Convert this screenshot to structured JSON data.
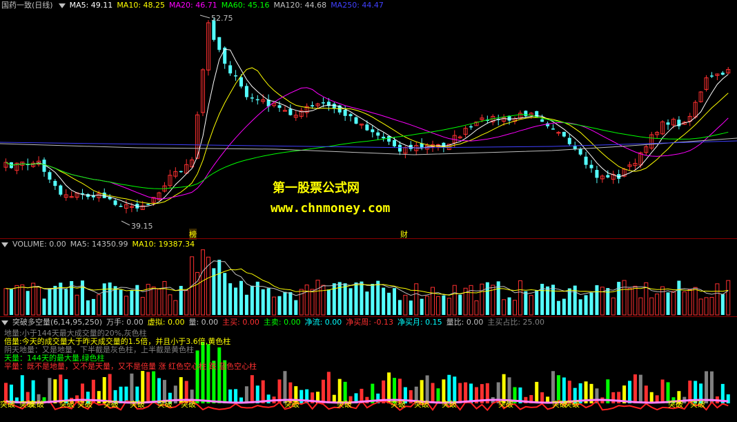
{
  "price_panel": {
    "title": "国药一致(日线)",
    "ma_labels": [
      {
        "text": "MA5: 49.11",
        "color": "#ffffff"
      },
      {
        "text": "MA10: 48.25",
        "color": "#ffff00"
      },
      {
        "text": "MA20: 46.71",
        "color": "#ff00ff"
      },
      {
        "text": "MA60: 45.16",
        "color": "#00ff00"
      },
      {
        "text": "MA120: 44.68",
        "color": "#c0c0c0"
      },
      {
        "text": "MA250: 44.47",
        "color": "#4040ff"
      }
    ],
    "high_label": "52.75",
    "low_label": "39.15",
    "marker_bang": "榜",
    "marker_cai": "财",
    "watermark_cn": "第一股票公式网",
    "watermark_url": "www.chnmoney.com"
  },
  "volume_panel": {
    "labels": [
      {
        "text": "VOLUME: 0.00",
        "color": "#c0c0c0"
      },
      {
        "text": "MA5: 14350.99",
        "color": "#c0c0c0"
      },
      {
        "text": "MA10: 19387.34",
        "color": "#ffff00"
      }
    ]
  },
  "indicator_panel": {
    "labels": [
      {
        "text": "突破多空量(6,14,95,250)",
        "color": "#c0c0c0"
      },
      {
        "text": "万手: 0.00",
        "color": "#c0c0c0"
      },
      {
        "text": "虚拟: 0.00",
        "color": "#ffff00"
      },
      {
        "text": "量: 0.00",
        "color": "#c0c0c0"
      },
      {
        "text": "主买: 0.00",
        "color": "#ff3030"
      },
      {
        "text": "主卖: 0.00",
        "color": "#00ff00"
      },
      {
        "text": "净流: 0.00",
        "color": "#00ffff"
      },
      {
        "text": "净买周: -0.13",
        "color": "#ff3030"
      },
      {
        "text": "净买月: 0.15",
        "color": "#00ffff"
      },
      {
        "text": "量比: 0.00",
        "color": "#c0c0c0"
      },
      {
        "text": "主买占比: 25.00",
        "color": "#808080"
      }
    ],
    "legend": [
      {
        "text": "地量:小于144天最大成交量的20%,灰色柱",
        "color": "#808080"
      },
      {
        "text": "倍量:今天的成交量大于昨天成交量的1.5倍，并且小于3.6倍,黄色柱",
        "color": "#ffff00"
      },
      {
        "text": "阴天地量：又是地量，下半截是灰色柱，上半截是黄色柱",
        "color": "#808080"
      },
      {
        "text": "天量：144天的最大量,绿色柱",
        "color": "#00ff00"
      },
      {
        "text": "平量：既不是地量，又不是天量，又不是倍量 涨 红色空心柱 跌 蓝色空心柱",
        "color": "#ff3030"
      }
    ],
    "tupo_label": "突破"
  },
  "colors": {
    "up": "#ff3030",
    "down": "#54ffff",
    "background": "#000000",
    "separator": "#8b0000"
  }
}
